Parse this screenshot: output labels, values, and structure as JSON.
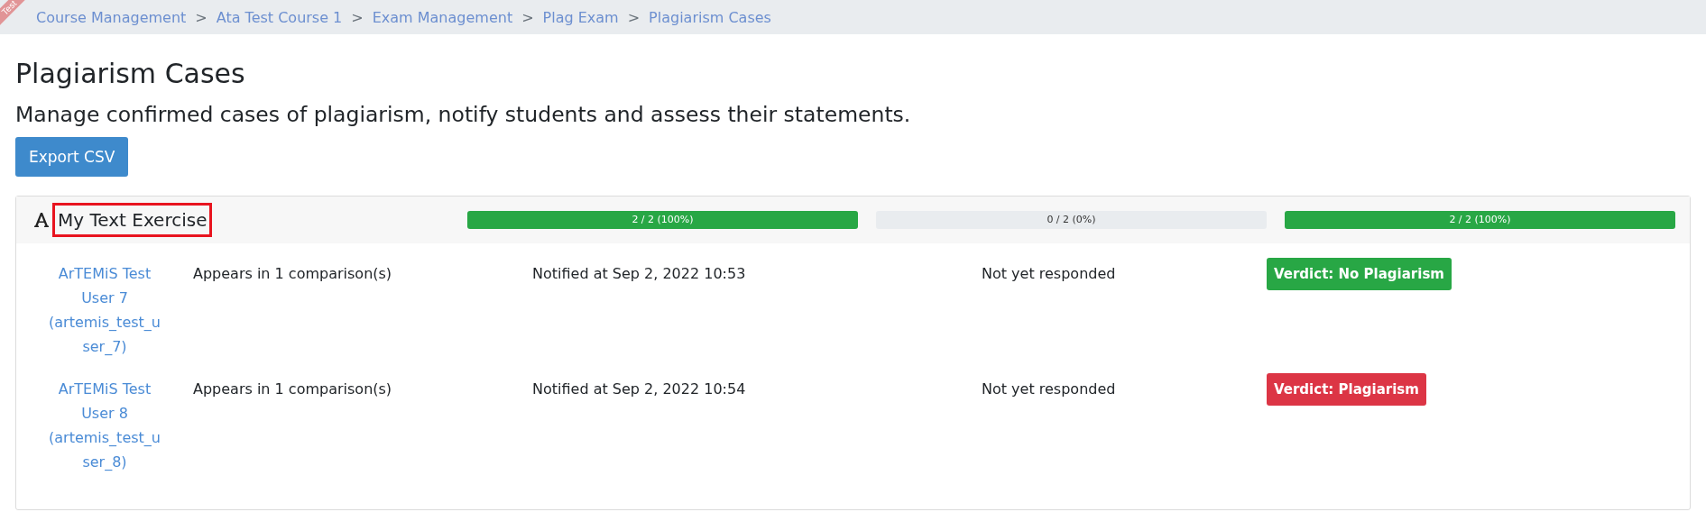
{
  "ribbon": {
    "text": "Test"
  },
  "breadcrumb": [
    {
      "label": "Course Management"
    },
    {
      "label": "Ata Test Course 1"
    },
    {
      "label": "Exam Management"
    },
    {
      "label": "Plag Exam"
    },
    {
      "label": "Plagiarism Cases"
    }
  ],
  "breadcrumb_separator": ">",
  "title": "Plagiarism Cases",
  "subtitle": "Manage confirmed cases of plagiarism, notify students and assess their statements.",
  "export_button": "Export CSV",
  "exercise": {
    "title": "My Text Exercise",
    "highlighted": true,
    "progress": [
      {
        "label": "2 / 2 (100%)",
        "level": 1
      },
      {
        "label": "0 / 2 (0%)",
        "level": 0
      },
      {
        "label": "2 / 2 (100%)",
        "level": 1
      }
    ],
    "rows": [
      {
        "student": "ArTEMiS Test User 7 (artemis_test_user_7)",
        "comparisons": "Appears in 1 comparison(s)",
        "notified": "Notified at Sep 2, 2022 10:53",
        "response": "Not yet responded",
        "verdict": "Verdict: No Plagiarism",
        "color": "#28a745"
      },
      {
        "student": "ArTEMiS Test User 8 (artemis_test_user_8)",
        "comparisons": "Appears in 1 comparison(s)",
        "notified": "Notified at Sep 2, 2022 10:54",
        "response": "Not yet responded",
        "verdict": "Verdict: Plagiarism",
        "color": "#dc3545"
      }
    ]
  }
}
